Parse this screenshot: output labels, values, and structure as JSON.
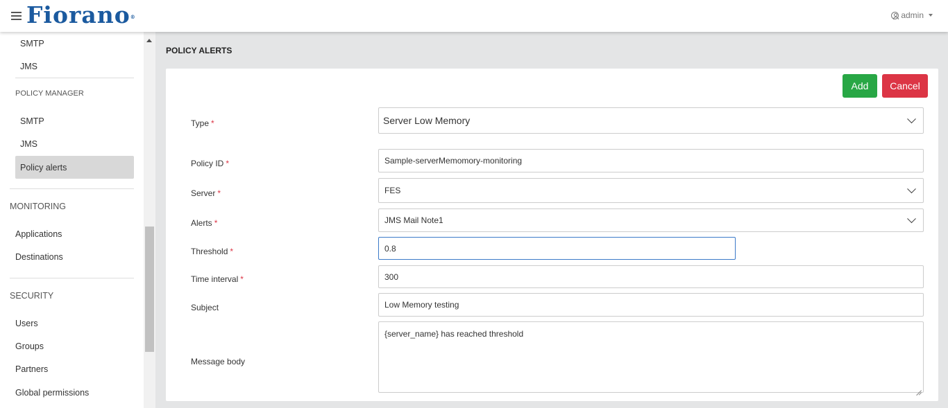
{
  "header": {
    "logo_text": "Fiorano",
    "logo_mark": "®",
    "user_label": "admin"
  },
  "sidebar": {
    "top_items": [
      "SMTP",
      "JMS"
    ],
    "policy_manager": {
      "heading": "POLICY MANAGER",
      "items": [
        "SMTP",
        "JMS",
        "Policy alerts"
      ]
    },
    "monitoring": {
      "heading": "MONITORING",
      "items": [
        "Applications",
        "Destinations"
      ]
    },
    "security": {
      "heading": "SECURITY",
      "items": [
        "Users",
        "Groups",
        "Partners",
        "Global permissions"
      ]
    }
  },
  "page": {
    "title": "POLICY ALERTS"
  },
  "form": {
    "add_label": "Add",
    "cancel_label": "Cancel",
    "type": {
      "label": "Type",
      "value": "Server Low Memory"
    },
    "policy_id": {
      "label": "Policy ID",
      "value": "Sample-serverMemomory-monitoring"
    },
    "server": {
      "label": "Server",
      "value": "FES"
    },
    "alerts": {
      "label": "Alerts",
      "value": "JMS Mail Note1"
    },
    "threshold": {
      "label": "Threshold",
      "value": "0.8"
    },
    "time_interval": {
      "label": "Time interval",
      "value": "300"
    },
    "subject": {
      "label": "Subject",
      "value": "Low Memory testing"
    },
    "message_body": {
      "label": "Message body",
      "value": "{server_name} has reached threshold"
    },
    "required_mark": "*"
  },
  "colors": {
    "brand": "#1b5a9f",
    "add": "#28a745",
    "cancel": "#dc3545",
    "focus": "#3b7ac9"
  }
}
